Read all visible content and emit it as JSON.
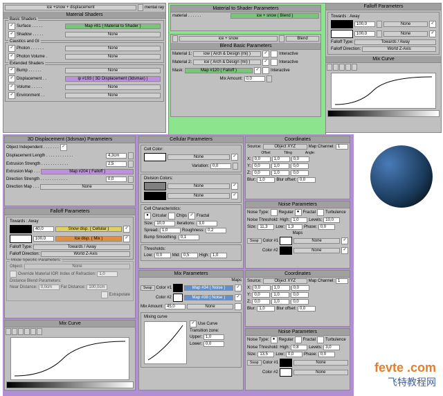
{
  "matShaders": {
    "title": "Material Shaders",
    "dd": "ice +snow + displacement",
    "renderer": "mental ray",
    "basic": {
      "title": "Basic Shaders",
      "surface": "Surface . . . . .",
      "surfBtn": "Map #81 ( Material to Shader )",
      "shadow": "Shadow . . . . .",
      "none": "None"
    },
    "caustics": {
      "title": "Caustics and GI",
      "photon": "Photon . . . . . .",
      "photonVol": "Photon Volume .",
      "none": "None"
    },
    "ext": {
      "title": "Extended Shaders",
      "bump": "Bump . . . . . .",
      "disp": "Displacement . .",
      "dispBtn": "ip #193 ( 3D Displacement (3dsmax) )",
      "volume": "Volume . . . . .",
      "env": "Environment . .",
      "none": "None"
    }
  },
  "matToShader": {
    "title": "Material to Shader Parameters",
    "material": "material . . . . . .",
    "btn": "ice + snow ( Blend )"
  },
  "blend": {
    "dd": "ice + snow",
    "btn": "Blend",
    "title": "Blend Basic Parameters",
    "mat1": "Material 1:",
    "m1btn": "iow  ( Arch & Design (mi) )",
    "mat2": "Material 2:",
    "m2btn": "ice  ( Arch & Design (mi) )",
    "mask": "Mask:",
    "maskBtn": "Map #120 ( Falloff )",
    "interactive": "Interactive",
    "mixAmt": "Mix Amount:",
    "mixVal": "0,0"
  },
  "falloff1": {
    "title": "Falloff Parameters",
    "towards": "Towards : Away",
    "v1": "100,0",
    "v2": "100,0",
    "none": "None",
    "ftype": "Falloff Type:",
    "ftypeV": "Towards / Away",
    "fdir": "Falloff Direction:",
    "fdirV": "World Z-Axis"
  },
  "mixCurve1": {
    "title": "Mix Curve"
  },
  "disp3d": {
    "title": "3D Displacement (3dsmax) Parameters",
    "objInd": "Object Independent . . . . . . .",
    "dlen": "Displacement Length . . . . . . . . . . . .",
    "dlenV": "4,3cm",
    "estr": "Extrusion Strength . . . . . . . . . . . .",
    "estrV": "2,5",
    "emap": "Extrusion Map . . .",
    "emapBtn": "Map #204 ( Falloff )",
    "dstr": "Direction Strength . . . . . . . . . . . .",
    "dstrV": "0,0",
    "dmap": "Direction Map . . .",
    "none": "None"
  },
  "falloff2": {
    "title": "Falloff Parameters",
    "towards": "Towards : Away",
    "v1": "40,0",
    "v2": "100,0",
    "b1": "Snow disp. ( Cellular )",
    "b2": "Ice disp.   ( Mix )",
    "ftype": "Falloff Type:",
    "ftypeV": "Towards / Away",
    "fdir": "Falloff Direction:",
    "fdirV": "World Z-Axis",
    "mode": "Mode Specific Parameters:",
    "obj": "Object:",
    "none": "None",
    "override": "Override Material IOR",
    "ior": "Index of Refraction:",
    "iorV": "1,0",
    "dbp": "Distance Blend Parameters:",
    "near": "Near Distance:",
    "nearV": "0,0cm",
    "far": "Far Distance:",
    "farV": "100,0cm",
    "extrap": "Extrapolate"
  },
  "mixCurve2": {
    "title": "Mix Curve"
  },
  "cellular": {
    "title": "Cellular Parameters",
    "cellColor": "Cell Color:",
    "none": "None",
    "variation": "Variation:",
    "varV": "0,0",
    "divColors": "Division Colors:",
    "cellChar": "Cell Characteristics:",
    "circular": "Circular",
    "chips": "Chips",
    "fractal": "Fractal",
    "size": "Size:",
    "sizeV": "10,0",
    "iter": "Iterations:",
    "iterV": "3,0",
    "spread": "Spread:",
    "spreadV": "1,0",
    "bump": "Bump Smoothing:",
    "bumpV": "0,1",
    "rough": "Roughness:",
    "roughV": "0,2",
    "thresh": "Thresholds:",
    "low": "Low:",
    "lowV": "0,0",
    "mid": "Mid:",
    "midV": "0,5",
    "high": "High:",
    "highV": "1,0"
  },
  "mix": {
    "title": "Mix Parameters",
    "maps": "Maps",
    "swap": "Swap",
    "c1": "Color #1",
    "c2": "Color #2",
    "m1": "Map #34 ( Noise )",
    "m2": "Map #38 ( Noise )",
    "mixAmt": "Mix Amount:",
    "mixV": "45,0",
    "none": "None",
    "mcurve": "Mixing curve",
    "useCurve": "Use Curve",
    "tzone": "Transition zone:",
    "upper": "Upper:",
    "upperV": "1,0",
    "lower": "Lower:",
    "lowerV": "0,0"
  },
  "coords1": {
    "title": "Coordinates",
    "source": "Source:",
    "srcV": "Object XYZ",
    "mapCh": "Map Channel:",
    "mchV": "1",
    "offset": "Offset",
    "tiling": "Tiling",
    "angle": "Angle:",
    "x": "X:",
    "y": "Y:",
    "z": "Z:",
    "xo": "0,0",
    "xt": "1,0",
    "xa": "0,0",
    "yo": "0,0",
    "yt": "1,0",
    "ya": "0,0",
    "zo": "0,0",
    "zt": "1,0",
    "za": "0,0",
    "blur": "Blur:",
    "blurV": "1,0",
    "boff": "Blur offset:",
    "boffV": "0,0"
  },
  "noise1": {
    "title": "Noise Parameters",
    "ntype": "Noise Type:",
    "reg": "Regular",
    "frac": "Fractal",
    "turb": "Turbulence",
    "nthresh": "Noise Threshold:",
    "high": "High:",
    "highV": "1,0",
    "levels": "Levels:",
    "levV": "10,0",
    "size": "Size:",
    "sizeV": "11,3",
    "low": "Low:",
    "lowV": "1,3",
    "phase": "Phase:",
    "phV": "0,0",
    "maps": "Maps",
    "swap": "Swap",
    "c1": "Color #1",
    "c2": "Color #2",
    "none": "None"
  },
  "coords2": {
    "title": "Coordinates"
  },
  "noise2": {
    "title": "Noise Parameters",
    "highV": "0,8",
    "sizeV": "13,5",
    "lowV": "0,0",
    "levV": "3,0"
  },
  "watermark": {
    "site": "fevte .com",
    "cn": "飞特教程网"
  }
}
